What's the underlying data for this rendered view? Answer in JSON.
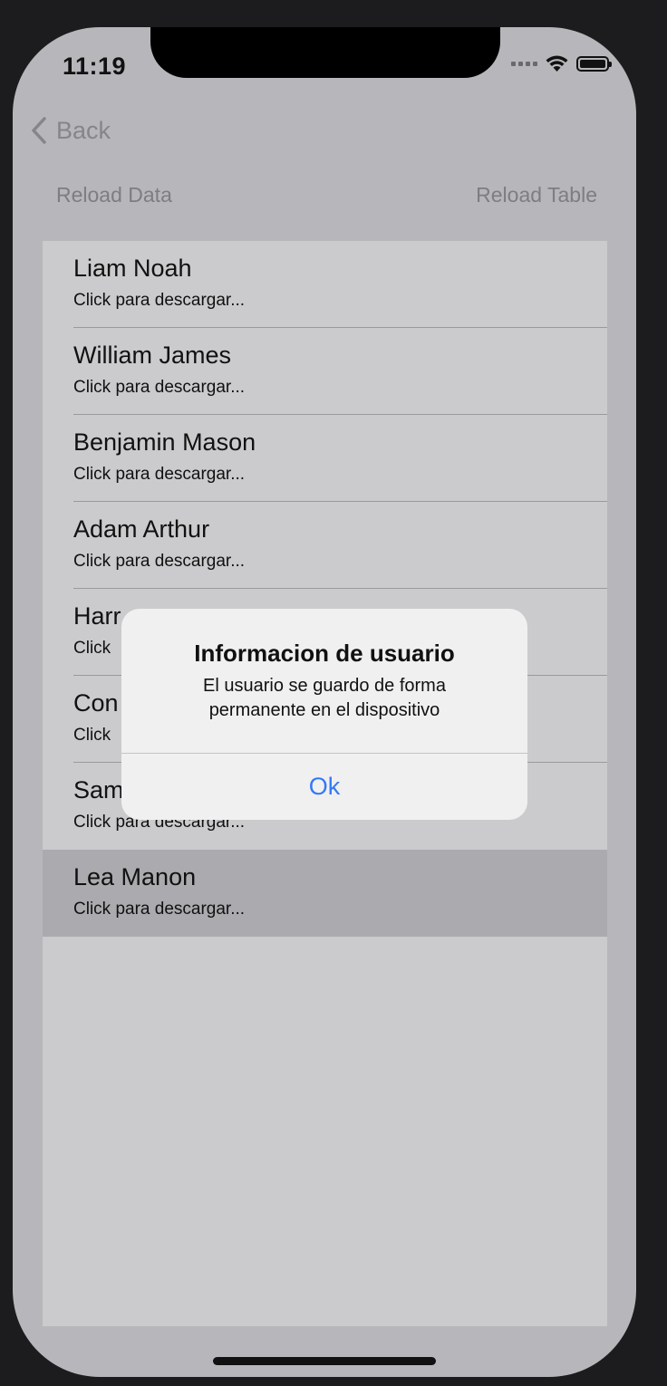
{
  "status_bar": {
    "time": "11:19"
  },
  "nav": {
    "back_label": "Back"
  },
  "toolbar": {
    "reload_data_label": "Reload Data",
    "reload_table_label": "Reload Table"
  },
  "table": {
    "rows": [
      {
        "title": "Liam Noah",
        "subtitle": "Click para descargar..."
      },
      {
        "title": "William James",
        "subtitle": "Click para descargar..."
      },
      {
        "title": "Benjamin Mason",
        "subtitle": "Click para descargar..."
      },
      {
        "title": "Adam Arthur",
        "subtitle": "Click para descargar..."
      },
      {
        "title": "Harr",
        "subtitle": "Click"
      },
      {
        "title": "Con",
        "subtitle": "Click"
      },
      {
        "title": "Sam",
        "subtitle": "Click para descargar..."
      },
      {
        "title": "Lea Manon",
        "subtitle": "Click para descargar...",
        "selected": true
      }
    ]
  },
  "alert": {
    "title": "Informacion de usuario",
    "message": "El usuario se guardo de forma permanente en el dispositivo",
    "button_label": "Ok"
  },
  "colors": {
    "accent": "#3478f6",
    "dimmed_background": "#b7b7bb",
    "selected_row": "#abaaae"
  }
}
